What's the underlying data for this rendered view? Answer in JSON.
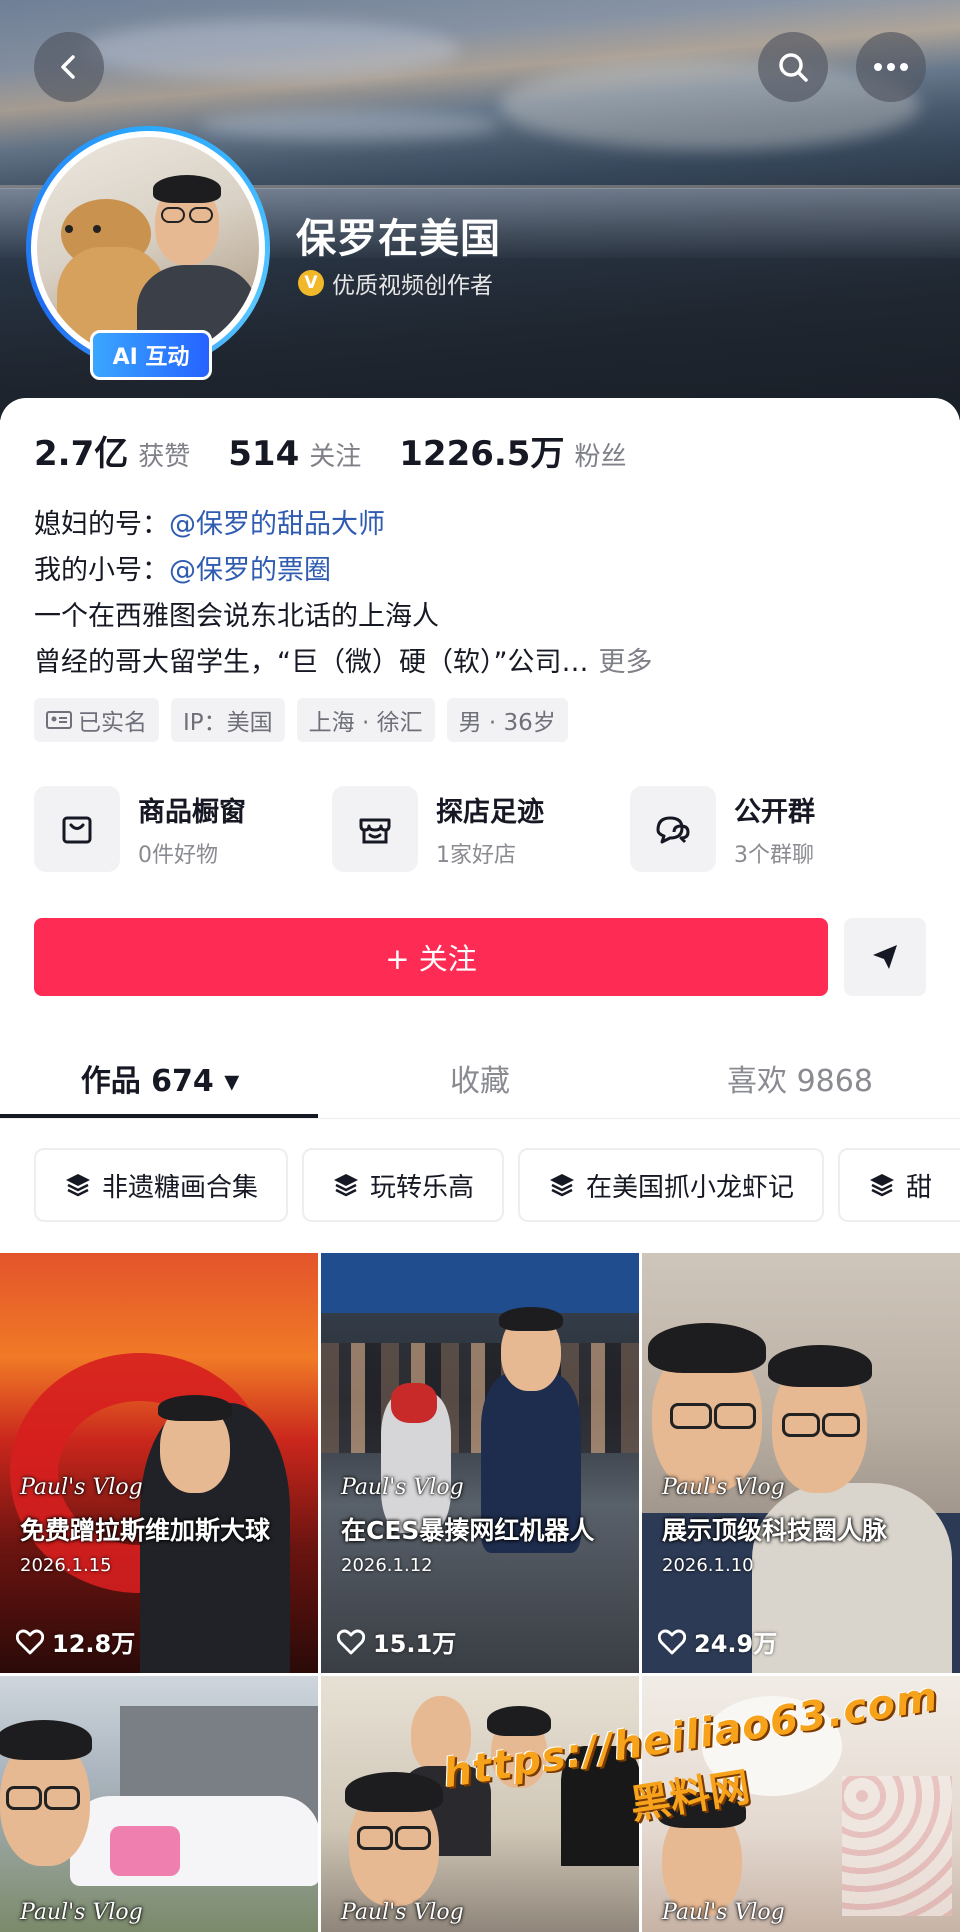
{
  "profile": {
    "name": "保罗在美国",
    "verify_text": "优质视频创作者",
    "verify_icon": "V",
    "ai_badge": "AI 互动"
  },
  "stats": [
    {
      "num": "2.7亿",
      "label": "获赞"
    },
    {
      "num": "514",
      "label": "关注"
    },
    {
      "num": "1226.5万",
      "label": "粉丝"
    }
  ],
  "bio": {
    "line1_prefix": "媳妇的号：",
    "line1_mention": "@保罗的甜品大师",
    "line2_prefix": "我的小号：",
    "line2_mention": "@保罗的票圈",
    "line3": "一个在西雅图会说东北话的上海人",
    "line4": "曾经的哥大留学生，“巨（微）硬（软）”公司…",
    "more": "更多"
  },
  "tags": [
    "已实名",
    "IP：美国",
    "上海 · 徐汇",
    "男 · 36岁"
  ],
  "features": [
    {
      "title": "商品橱窗",
      "sub": "0件好物"
    },
    {
      "title": "探店足迹",
      "sub": "1家好店"
    },
    {
      "title": "公开群",
      "sub": "3个群聊"
    }
  ],
  "follow_label": "+ 关注",
  "tabs": [
    {
      "label": "作品 674 ▾"
    },
    {
      "label": "收藏"
    },
    {
      "label": "喜欢 9868"
    }
  ],
  "collections": [
    "非遗糖画合集",
    "玩转乐高",
    "在美国抓小龙虾记",
    "甜"
  ],
  "videos": [
    {
      "vlog": "Paul's Vlog",
      "title": "免费蹭拉斯维加斯大球",
      "date": "2026.1.15",
      "likes": "12.8万"
    },
    {
      "vlog": "Paul's Vlog",
      "title": "在CES暴揍网红机器人",
      "date": "2026.1.12",
      "likes": "15.1万"
    },
    {
      "vlog": "Paul's Vlog",
      "title": "展示顶级科技圈人脉",
      "date": "2026.1.10",
      "likes": "24.9万"
    },
    {
      "vlog": "Paul's Vlog"
    },
    {
      "vlog": "Paul's Vlog"
    },
    {
      "vlog": "Paul's Vlog"
    }
  ],
  "watermark": {
    "url": "https://heiliao63.com",
    "text": "黑料网"
  },
  "colors": {
    "accent": "#fe2c55",
    "mention": "#2f5bb0",
    "ai_badge": "#2563ff"
  }
}
